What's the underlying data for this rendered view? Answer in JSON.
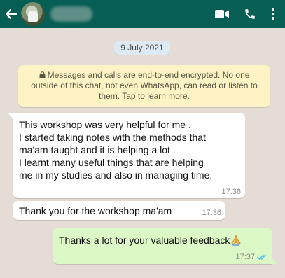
{
  "header": {
    "back_icon": "arrow-left-icon",
    "video_icon": "video-camera-icon",
    "call_icon": "phone-icon",
    "menu_icon": "more-vertical-icon",
    "color": "#075e54"
  },
  "chat": {
    "date": "9 July 2021",
    "encryption_notice": "Messages and calls are end-to-end encrypted. No one outside of this chat, not even WhatsApp, can read or listen to them. Tap to learn more.",
    "messages": [
      {
        "direction": "incoming",
        "lines": [
          "This workshop was very helpful for me .",
          "I started taking notes with the methods that",
          "ma'am taught and it is helping a lot .",
          "I learnt many useful things that are helping",
          "me in my studies and also in managing time."
        ],
        "time": "17:36"
      },
      {
        "direction": "incoming",
        "text": "Thank you for the workshop ma'am",
        "time": "17:36"
      },
      {
        "direction": "outgoing",
        "text": "Thanks a lot for your valuable feedback",
        "emoji": "folded-hands-emoji",
        "time": "17:37",
        "status": "read"
      }
    ],
    "colors": {
      "incoming": "#ffffff",
      "outgoing": "#dcf8c6",
      "read_ticks": "#4fc3f7"
    }
  }
}
